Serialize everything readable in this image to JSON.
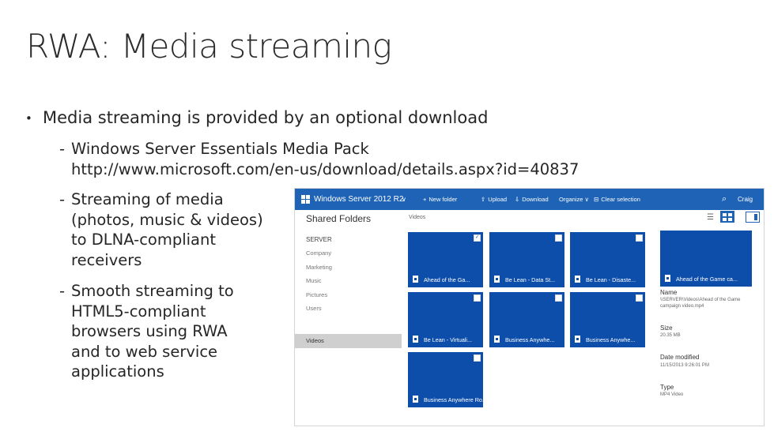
{
  "slide": {
    "title": "RWA: Media streaming",
    "bullet1": "Media streaming is provided by an optional download",
    "sub1": [
      "Windows Server Essentials Media Pack",
      "http://www.microsoft.com/en-us/download/details.aspx?id=40837"
    ],
    "sub2": [
      "Streaming of media",
      "(photos, music & videos)",
      "to DLNA-compliant",
      "receivers"
    ],
    "sub3": [
      "Smooth streaming to",
      "HTML5-compliant",
      "browsers using RWA",
      "and to web service",
      "applications"
    ],
    "bullet_glyph": "•",
    "dash_glyph": "-"
  },
  "app": {
    "title": "Windows Server 2012 R2",
    "title_chevron": "∨",
    "toolbar": {
      "new_folder": "New folder",
      "upload": "Upload",
      "download": "Download",
      "organize": "Organize ∨",
      "clear_selection": "Clear selection"
    },
    "user": "Craig",
    "search_icon": "search-icon",
    "accent_color": "#1e63b6",
    "tile_color": "#0d4eab",
    "sidebar": {
      "heading": "Shared Folders",
      "items": [
        "SERVER",
        "Company",
        "Marketing",
        "Music",
        "Pictures",
        "Users",
        "Videos"
      ],
      "selected": "Videos"
    },
    "breadcrumb": "Videos",
    "tiles": [
      {
        "caption": "Ahead of the Ga...",
        "checked": true
      },
      {
        "caption": "Be Lean - Data St...",
        "checked": false
      },
      {
        "caption": "Be Lean - Disaste...",
        "checked": false
      },
      {
        "caption": "Ahead of the Game ca...",
        "checked": false
      },
      {
        "caption": "Be Lean - Virtuali...",
        "checked": false
      },
      {
        "caption": "Business Anywhe...",
        "checked": false
      },
      {
        "caption": "Business Anywhe...",
        "checked": false
      },
      {
        "caption": "Business Anywhere Ro...",
        "checked": false
      }
    ],
    "details": {
      "name_label": "Name",
      "name_value_1": "\\\\SERVER\\Videos\\Ahead of the Game",
      "name_value_2": "campaign video.mp4",
      "size_label": "Size",
      "size_value": "20.35 MB",
      "date_label": "Date modified",
      "date_value": "11/15/2013 9:26:01 PM",
      "type_label": "Type",
      "type_value": "MP4 Video"
    },
    "check_glyph": "✓"
  }
}
